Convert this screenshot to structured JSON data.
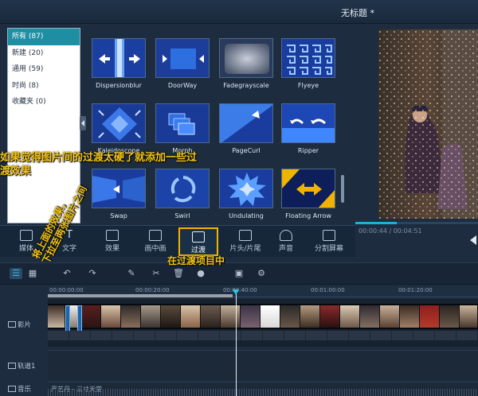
{
  "window": {
    "title": "无标题 *"
  },
  "categories": [
    {
      "label": "所有 (87)",
      "selected": true
    },
    {
      "label": "新建 (20)",
      "selected": false
    },
    {
      "label": "通用 (59)",
      "selected": false
    },
    {
      "label": "时尚 (8)",
      "selected": false
    },
    {
      "label": "收藏夹 (0)",
      "selected": false
    }
  ],
  "effects": [
    {
      "label": "Dispersionblur",
      "icon": "dispersion-blur-thumb"
    },
    {
      "label": "DoorWay",
      "icon": "doorway-thumb"
    },
    {
      "label": "Fadegrayscale",
      "icon": "fade-grayscale-thumb"
    },
    {
      "label": "Flyeye",
      "icon": "flyeye-thumb"
    },
    {
      "label": "Kaleidoscope",
      "icon": "kaleidoscope-thumb"
    },
    {
      "label": "Morph",
      "icon": "morph-thumb"
    },
    {
      "label": "PageCurl",
      "icon": "page-curl-thumb"
    },
    {
      "label": "Ripper",
      "icon": "ripper-thumb"
    },
    {
      "label": "Swap",
      "icon": "swap-thumb"
    },
    {
      "label": "Swirl",
      "icon": "swirl-thumb"
    },
    {
      "label": "Undulating",
      "icon": "undulating-thumb"
    },
    {
      "label": "Floating Arrow",
      "icon": "floating-arrow-thumb"
    }
  ],
  "preview": {
    "time": "00:00:44 / 00:04:51",
    "progress": 0.34
  },
  "tabs": [
    {
      "label": "媒体",
      "icon": "media-icon"
    },
    {
      "label": "文字",
      "icon": "text-icon"
    },
    {
      "label": "效果",
      "icon": "effects-icon"
    },
    {
      "label": "画中画",
      "icon": "pip-icon"
    },
    {
      "label": "过渡",
      "icon": "transition-icon",
      "active": true
    },
    {
      "label": "片头/片尾",
      "icon": "intro-outro-icon"
    },
    {
      "label": "声音",
      "icon": "audio-icon"
    },
    {
      "label": "分割屏幕",
      "icon": "split-screen-icon"
    }
  ],
  "toolbar": {
    "icons": [
      "timeline-view-icon",
      "storyboard-view-icon",
      "undo-icon",
      "redo-icon",
      "edit-icon",
      "cut-icon",
      "delete-icon",
      "record-icon",
      "snapshot-icon",
      "settings-icon"
    ]
  },
  "ruler": [
    "00:00:00:00",
    "00:00:20:00",
    "00:00:40:00",
    "00:01:00:00",
    "00:01:20:00"
  ],
  "tracks": {
    "video": "影片",
    "overlay": "轨道1",
    "music": "音乐",
    "music_clip": "严艺丹 - 三寸天堂"
  },
  "annotations": {
    "tip1": "如果觉得图片间的过渡太硬了就添加一些过渡效果",
    "tip2": "在过渡项目中",
    "tip3_lines": [
      "将上面的效果，",
      "下拉至两张图片之间"
    ]
  },
  "colors": {
    "accent": "#1e8ea3",
    "highlight": "#f3b400",
    "annotation": "#f3c418",
    "background": "#1d2c3f"
  }
}
